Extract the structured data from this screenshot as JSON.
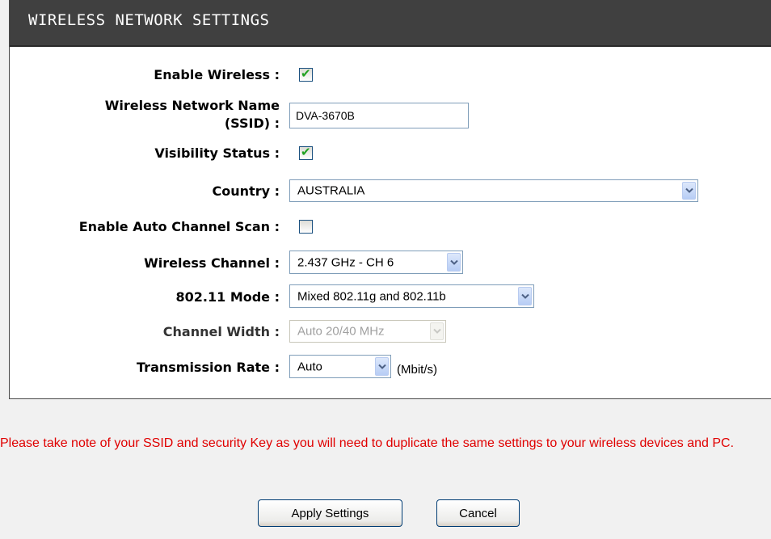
{
  "section": {
    "title": "WIRELESS NETWORK SETTINGS"
  },
  "fields": {
    "enable_wireless": {
      "label": "Enable Wireless :",
      "checked": true,
      "check_glyph": "✔"
    },
    "ssid": {
      "label_line1": "Wireless Network Name",
      "label_line2": "(SSID) :",
      "value": "DVA-3670B"
    },
    "visibility_status": {
      "label": "Visibility Status :",
      "checked": true,
      "check_glyph": "✔"
    },
    "country": {
      "label": "Country :",
      "selected": "AUSTRALIA"
    },
    "auto_channel_scan": {
      "label": "Enable Auto Channel Scan :",
      "checked": false,
      "check_glyph": ""
    },
    "wireless_channel": {
      "label": "Wireless Channel :",
      "selected": "2.437 GHz - CH 6"
    },
    "mode_80211": {
      "label": "802.11 Mode :",
      "selected": "Mixed 802.11g and 802.11b"
    },
    "channel_width": {
      "label": "Channel Width :",
      "selected": "Auto 20/40 MHz",
      "disabled": true
    },
    "transmission_rate": {
      "label": "Transmission Rate :",
      "selected": "Auto",
      "unit": "(Mbit/s)"
    }
  },
  "note": "Please take note of your SSID and security Key as you will need to duplicate the same settings to your wireless devices and PC.",
  "buttons": {
    "apply": "Apply Settings",
    "cancel": "Cancel"
  },
  "colors": {
    "header_bg": "#404040",
    "note_text": "#e00000",
    "check_green": "#21a121"
  },
  "icons": {
    "dropdown": "chevron-down-icon",
    "check": "checkmark-icon"
  }
}
